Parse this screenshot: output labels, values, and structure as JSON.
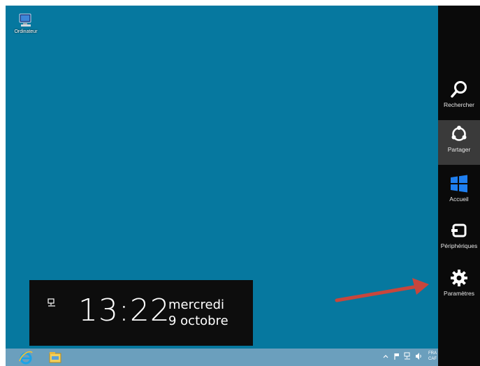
{
  "desktop": {
    "background_color": "#06789f",
    "icons": [
      {
        "label": "Ordinateur",
        "icon": "computer-icon"
      }
    ]
  },
  "charms": {
    "items": [
      {
        "label": "Rechercher",
        "icon": "search-icon",
        "selected": false
      },
      {
        "label": "Partager",
        "icon": "share-icon",
        "selected": true
      },
      {
        "label": "Accueil",
        "icon": "windows-start-icon",
        "selected": false
      },
      {
        "label": "Périphériques",
        "icon": "devices-icon",
        "selected": false
      },
      {
        "label": "Paramètres",
        "icon": "gear-icon",
        "selected": false
      }
    ]
  },
  "clock": {
    "time": "13:22",
    "day": "mercredi",
    "date": "9 octobre",
    "status_icon": "network-icon"
  },
  "annotation": {
    "icon": "red-arrow-icon",
    "color": "#c8463c"
  },
  "taskbar": {
    "pinned": [
      {
        "icon": "internet-explorer-icon"
      },
      {
        "icon": "file-explorer-icon"
      }
    ],
    "tray": {
      "icons": [
        "chevron-up-icon",
        "flag-icon",
        "network-icon",
        "volume-icon"
      ],
      "lang_line1": "FRA",
      "lang_line2": "CAF"
    }
  }
}
